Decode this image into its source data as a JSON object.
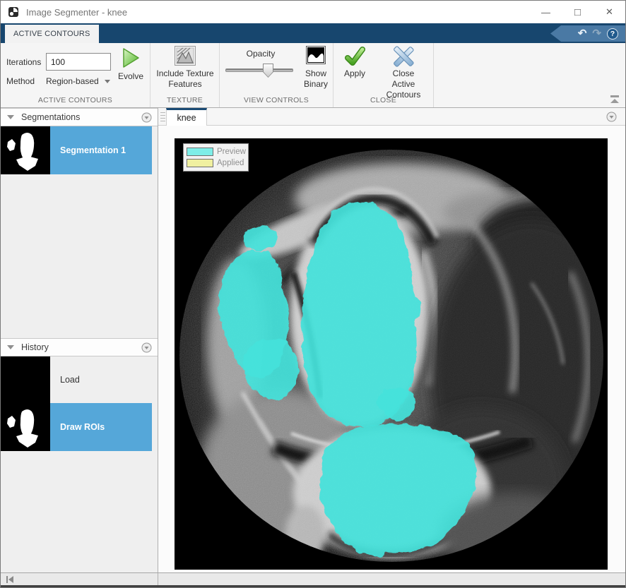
{
  "window": {
    "title": "Image Segmenter - knee"
  },
  "ribbon": {
    "tab_label": "ACTIVE CONTOURS",
    "quick_access": {
      "undo": "undo",
      "redo": "redo",
      "help": "?"
    }
  },
  "toolbar": {
    "iterations_label": "Iterations",
    "iterations_value": "100",
    "method_label": "Method",
    "method_value": "Region-based",
    "evolve_label": "Evolve",
    "texture_line1": "Include Texture",
    "texture_line2": "Features",
    "opacity_label": "Opacity",
    "opacity_percent": 60,
    "show_binary_line1": "Show",
    "show_binary_line2": "Binary",
    "apply_label": "Apply",
    "close_line1": "Close",
    "close_line2": "Active Contours",
    "sections": {
      "active_contours": "ACTIVE CONTOURS",
      "texture": "TEXTURE",
      "view_controls": "VIEW CONTROLS",
      "close": "CLOSE"
    }
  },
  "segmentations_panel": {
    "title": "Segmentations",
    "items": [
      {
        "label": "Segmentation 1",
        "selected": true
      }
    ]
  },
  "history_panel": {
    "title": "History",
    "items": [
      {
        "label": "Load",
        "selected": false
      },
      {
        "label": "Draw ROIs",
        "selected": true
      }
    ]
  },
  "document": {
    "tab_label": "knee",
    "legend": {
      "preview_label": "Preview",
      "applied_label": "Applied"
    }
  },
  "colors": {
    "selection_blue": "#55a7d9",
    "ribbon_navy": "#17466e",
    "preview_cyan": "#7deee8",
    "applied_yellow": "#f0f0a0"
  }
}
